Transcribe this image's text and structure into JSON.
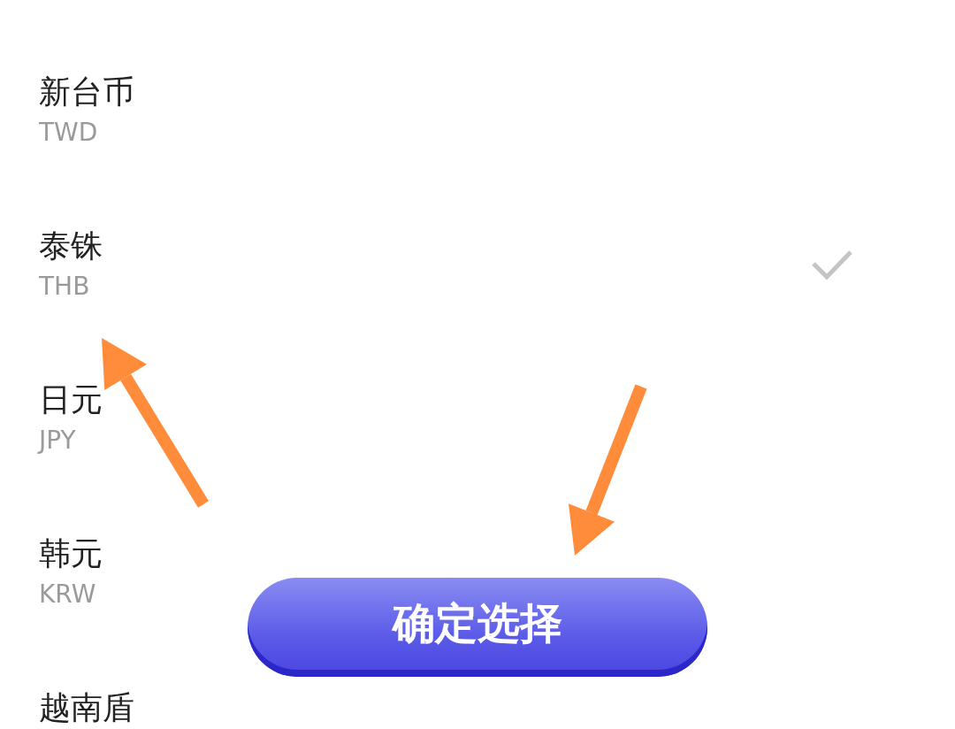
{
  "currencies": [
    {
      "name": "新台币",
      "code": "TWD",
      "selected": false
    },
    {
      "name": "泰铢",
      "code": "THB",
      "selected": true
    },
    {
      "name": "日元",
      "code": "JPY",
      "selected": false
    },
    {
      "name": "韩元",
      "code": "KRW",
      "selected": false
    },
    {
      "name": "越南盾",
      "selected": false
    }
  ],
  "confirm_button": {
    "label": "确定选择"
  }
}
